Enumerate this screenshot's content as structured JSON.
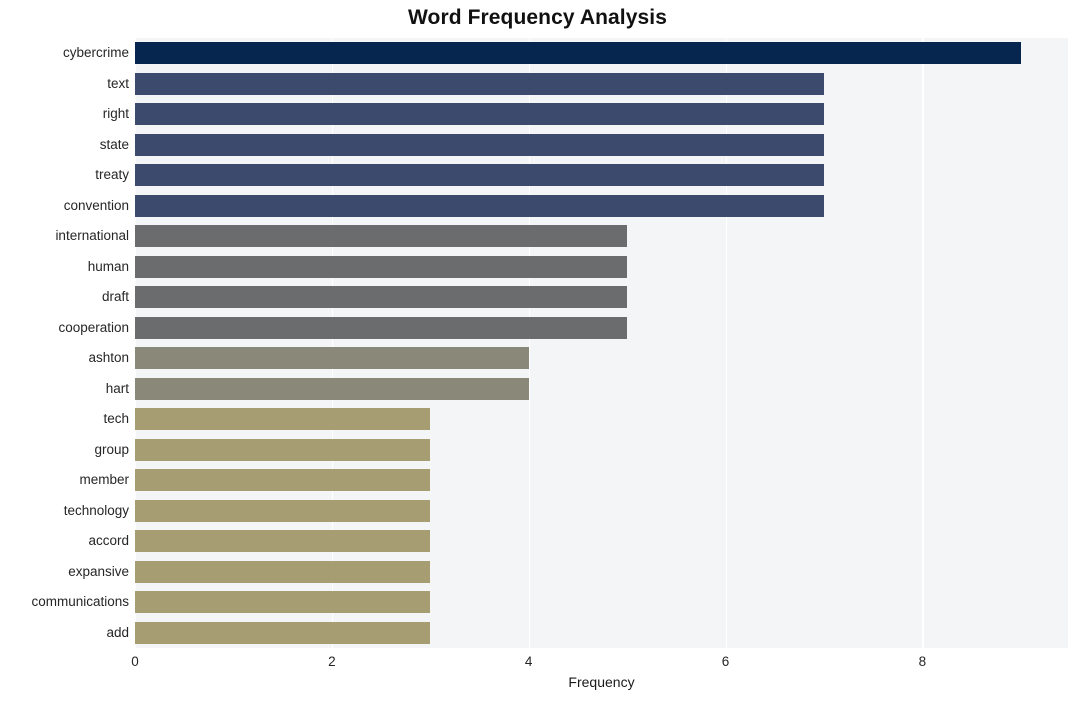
{
  "chart_data": {
    "type": "bar",
    "orientation": "horizontal",
    "title": "Word Frequency Analysis",
    "xlabel": "Frequency",
    "ylabel": "",
    "categories": [
      "cybercrime",
      "text",
      "right",
      "state",
      "treaty",
      "convention",
      "international",
      "human",
      "draft",
      "cooperation",
      "ashton",
      "hart",
      "tech",
      "group",
      "member",
      "technology",
      "accord",
      "expansive",
      "communications",
      "add"
    ],
    "values": [
      9,
      7,
      7,
      7,
      7,
      7,
      5,
      5,
      5,
      5,
      4,
      4,
      3,
      3,
      3,
      3,
      3,
      3,
      3,
      3
    ],
    "bar_colors": [
      "#062650",
      "#3c4a6e",
      "#3c4a6e",
      "#3c4a6e",
      "#3c4a6e",
      "#3c4a6e",
      "#6b6c6e",
      "#6b6c6e",
      "#6b6c6e",
      "#6b6c6e",
      "#8a8878",
      "#8a8878",
      "#a79d72",
      "#a79d72",
      "#a79d72",
      "#a79d72",
      "#a79d72",
      "#a79d72",
      "#a79d72",
      "#a79d72"
    ],
    "xlim": [
      0,
      9.48
    ],
    "xticks": [
      0,
      2,
      4,
      6,
      8
    ],
    "xtick_labels": [
      "0",
      "2",
      "4",
      "6",
      "8"
    ],
    "grid": true,
    "grid_axis": "x",
    "grid_color": "#ffffff",
    "plot_background": "#f4f5f6",
    "figure_background": "#ffffff",
    "legend": null
  }
}
